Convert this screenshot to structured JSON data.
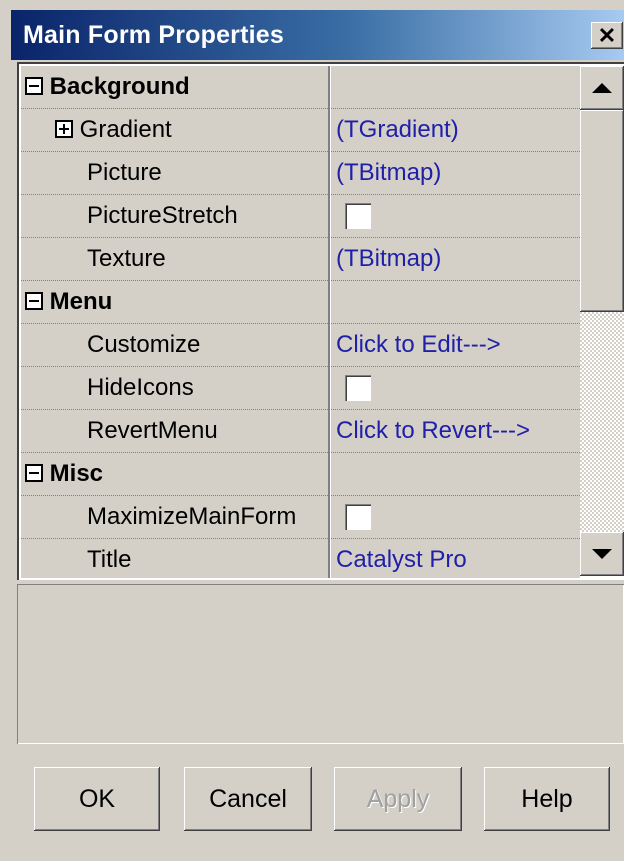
{
  "window": {
    "title": "Main Form Properties",
    "close_glyph": "✕"
  },
  "grid": {
    "categories": {
      "background": "Background",
      "menu": "Menu",
      "misc": "Misc"
    },
    "properties": {
      "gradient": {
        "name": "Gradient",
        "value": "(TGradient)"
      },
      "picture": {
        "name": "Picture",
        "value": "(TBitmap)"
      },
      "picture_stretch": {
        "name": "PictureStretch",
        "checked": false
      },
      "texture": {
        "name": "Texture",
        "value": "(TBitmap)"
      },
      "customize": {
        "name": "Customize",
        "value": "Click to Edit--->"
      },
      "hide_icons": {
        "name": "HideIcons",
        "checked": false
      },
      "revert_menu": {
        "name": "RevertMenu",
        "value": "Click to Revert--->"
      },
      "maximize_main_form": {
        "name": "MaximizeMainForm",
        "checked": false
      },
      "title": {
        "name": "Title",
        "value": "Catalyst Pro"
      }
    }
  },
  "buttons": {
    "ok": "OK",
    "cancel": "Cancel",
    "apply": "Apply",
    "help": "Help"
  },
  "colors": {
    "value_text": "#1f1fa8",
    "titlebar_start": "#0a246a",
    "titlebar_end": "#a6caf0"
  }
}
